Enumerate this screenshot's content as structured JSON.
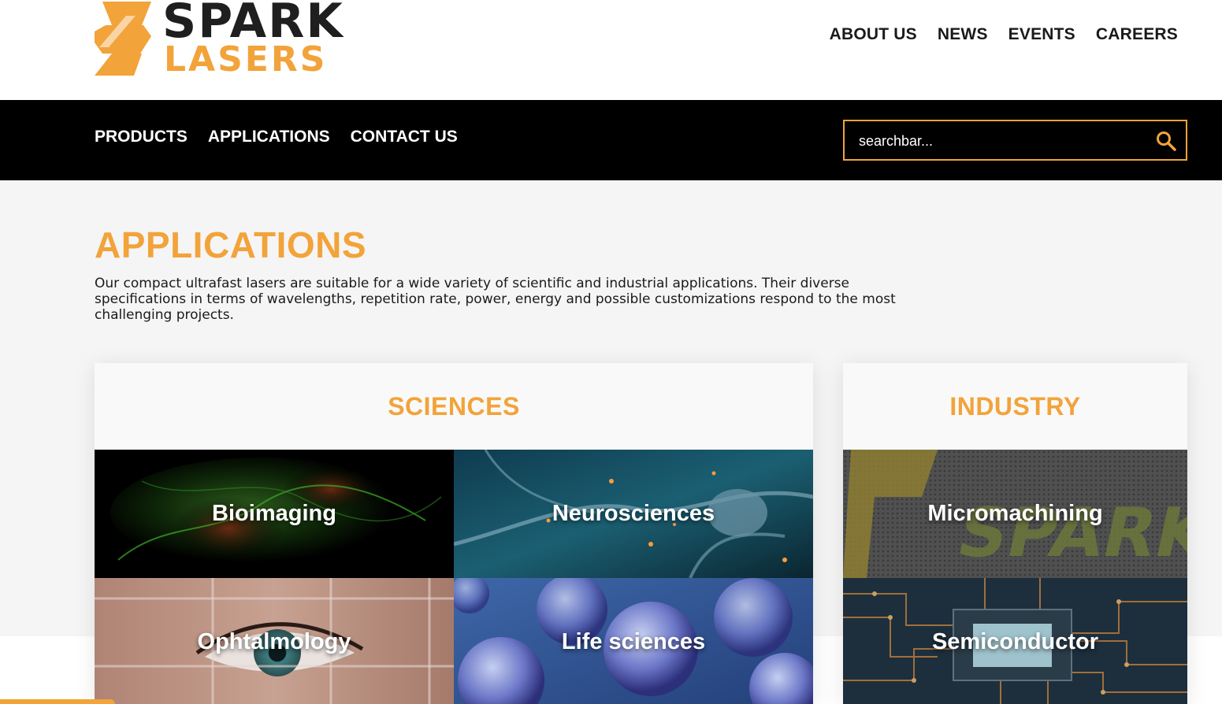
{
  "brand": {
    "name_line1": "SPARK",
    "name_line2": "LASERS",
    "colors": {
      "accent": "#f2a33a",
      "dark": "#1f1f1f"
    }
  },
  "top_nav": {
    "items": [
      {
        "label": "ABOUT US"
      },
      {
        "label": "NEWS"
      },
      {
        "label": "EVENTS"
      },
      {
        "label": "CAREERS"
      }
    ]
  },
  "main_nav": {
    "items": [
      {
        "label": "PRODUCTS"
      },
      {
        "label": "APPLICATIONS"
      },
      {
        "label": "CONTACT US"
      }
    ]
  },
  "search": {
    "placeholder": "searchbar...",
    "icon": "search-icon"
  },
  "page": {
    "title": "APPLICATIONS",
    "intro": "Our compact ultrafast lasers are suitable for a wide variety of scientific and industrial applications. Their diverse specifications in terms of wavelengths, repetition rate, power, energy and possible customizations respond to the most challenging projects."
  },
  "sections": {
    "sciences": {
      "title": "SCIENCES",
      "tiles": [
        {
          "label": "Bioimaging"
        },
        {
          "label": "Neurosciences"
        },
        {
          "label": "Ophtalmology"
        },
        {
          "label": "Life sciences"
        }
      ]
    },
    "industry": {
      "title": "INDUSTRY",
      "tiles": [
        {
          "label": "Micromachining"
        },
        {
          "label": "Semiconductor"
        }
      ]
    }
  }
}
